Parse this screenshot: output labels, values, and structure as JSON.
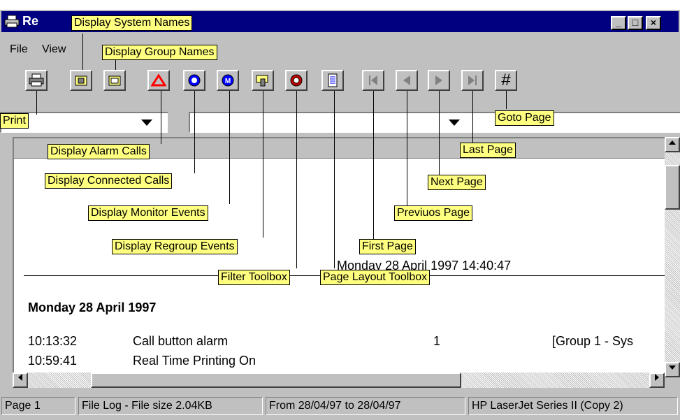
{
  "window": {
    "title": "Re",
    "minimize_label": "_",
    "maximize_label": "□",
    "close_label": "×"
  },
  "menu": {
    "file": "File",
    "view": "View"
  },
  "toolbar": {
    "goto_label": "#"
  },
  "tooltips": {
    "display_system_names": "Display System Names",
    "display_group_names": "Display Group Names",
    "print": "Print",
    "display_alarm_calls": "Display Alarm Calls",
    "display_connected_calls": "Display Connected Calls",
    "display_monitor_events": "Display Monitor Events",
    "display_regroup_events": "Display Regroup Events",
    "filter_toolbox": "Filter Toolbox",
    "page_layout_toolbox": "Page Layout Toolbox",
    "first_page": "First Page",
    "previous_page": "Previuos Page",
    "next_page": "Next Page",
    "last_page": "Last Page",
    "goto_page": "Goto Page"
  },
  "document": {
    "header_timestamp": "Monday 28 April 1997 14:40:47",
    "date_heading": "Monday 28 April 1997",
    "rows": [
      {
        "time": "10:13:32",
        "event": "Call button alarm",
        "count": "1",
        "group": "[Group 1 - Sys"
      },
      {
        "time": "10:59:41",
        "event": "Real Time Printing On",
        "count": "",
        "group": ""
      }
    ]
  },
  "status": {
    "page": "Page 1",
    "file": "File Log - File size 2.04KB",
    "range": "From 28/04/97 to 28/04/97",
    "printer": "HP LaserJet Series II (Copy 2)"
  },
  "colors": {
    "title_bar": "#000080",
    "tooltip_bg": "#ffff80",
    "face": "#c0c0c0"
  }
}
